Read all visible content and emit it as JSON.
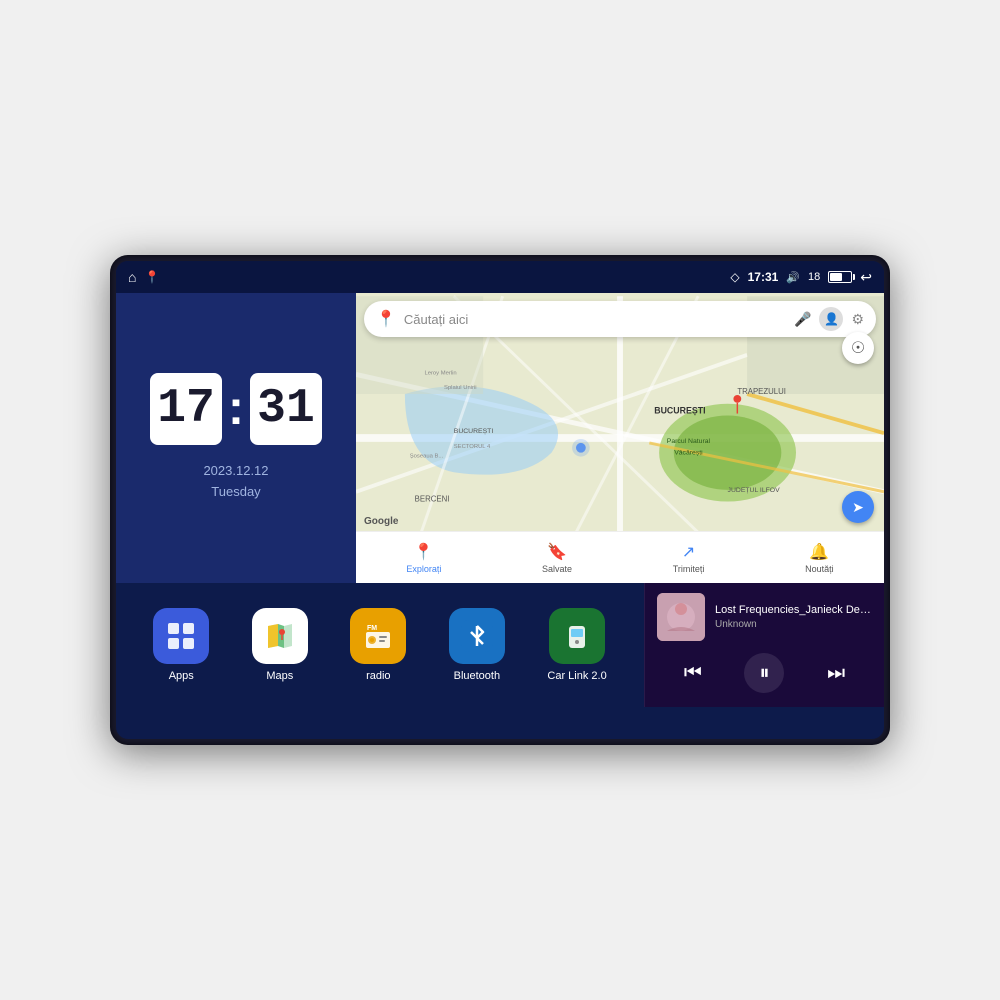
{
  "device": {
    "status_bar": {
      "location_icon": "◇",
      "time": "17:31",
      "volume_icon": "🔊",
      "volume_level": "18",
      "battery_icon": "🔋",
      "back_icon": "↩"
    },
    "left_nav": {
      "home_icon": "⌂",
      "maps_icon": "📍"
    },
    "clock": {
      "hour": "17",
      "minute": "31",
      "date": "2023.12.12",
      "day": "Tuesday"
    },
    "map": {
      "search_placeholder": "Căutați aici",
      "location_labels": [
        "Parcul Natural Văcărești",
        "BUCUREȘTI",
        "JUDEȚUL ILFOV",
        "BERCENI",
        "TRAPEZULUI",
        "Leroy Merlin"
      ],
      "nav_items": [
        {
          "label": "Explorați",
          "icon": "📍"
        },
        {
          "label": "Salvate",
          "icon": "🔖"
        },
        {
          "label": "Trimiteți",
          "icon": "↗"
        },
        {
          "label": "Noutăți",
          "icon": "🔔"
        }
      ]
    },
    "apps": [
      {
        "id": "apps",
        "label": "Apps",
        "icon": "⊞",
        "color": "#3b5bdb"
      },
      {
        "id": "maps",
        "label": "Maps",
        "icon": "🗺",
        "color": "#ffffff"
      },
      {
        "id": "radio",
        "label": "radio",
        "icon": "📻",
        "color": "#e8a000"
      },
      {
        "id": "bluetooth",
        "label": "Bluetooth",
        "icon": "🔷",
        "color": "#1971c2"
      },
      {
        "id": "carlink",
        "label": "Car Link 2.0",
        "icon": "📱",
        "color": "#1a7431"
      }
    ],
    "music": {
      "title": "Lost Frequencies_Janieck Devy-...",
      "artist": "Unknown",
      "prev_icon": "⏮",
      "play_icon": "⏸",
      "next_icon": "⏭"
    }
  }
}
